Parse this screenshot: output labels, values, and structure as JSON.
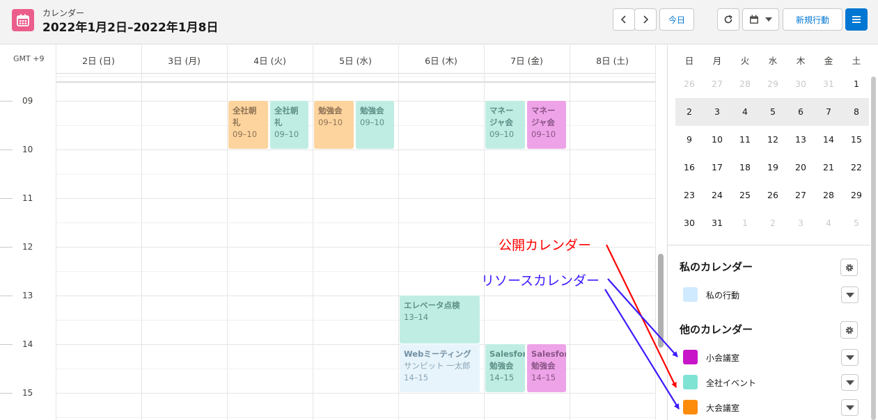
{
  "header": {
    "object_label": "カレンダー",
    "range_title": "2022年1月2日–2022年1月8日",
    "today_label": "今日",
    "new_event_label": "新規行動"
  },
  "timezone": "GMT +9",
  "days": [
    "2日 (日)",
    "3日 (月)",
    "4日 (火)",
    "5日 (水)",
    "6日 (木)",
    "7日 (金)",
    "8日 (土)"
  ],
  "hours": [
    "09",
    "10",
    "11",
    "12",
    "13",
    "14",
    "15"
  ],
  "events": [
    {
      "title": "全社朝礼",
      "sub": "09–10",
      "color": "#fdd49e"
    },
    {
      "title": "全社朝礼",
      "sub": "09–10",
      "color": "#bfede4"
    },
    {
      "title": "勉強会",
      "sub": "09–10",
      "color": "#fdd49e"
    },
    {
      "title": "勉強会",
      "sub": "09–10",
      "color": "#bfede4"
    },
    {
      "title": "マネージャ会",
      "sub": "09–10",
      "color": "#bfede4"
    },
    {
      "title": "マネージャ会",
      "sub": "09–10",
      "color": "#eea3e8"
    },
    {
      "title": "エレベータ点検",
      "sub": "13–14",
      "color": "#bfede4"
    },
    {
      "title": "Webミーティング",
      "sub": "サンピット 一太郎",
      "time": "14–15",
      "color": "#e8f4fb"
    },
    {
      "title": "Salesforce",
      "sub": "勉強会",
      "time": "14–15",
      "color": "#bfede4"
    },
    {
      "title": "Salesforce",
      "sub": "勉強会",
      "time": "14–15",
      "color": "#eea3e8"
    }
  ],
  "mini_calendar": {
    "weekdays": [
      "日",
      "月",
      "火",
      "水",
      "木",
      "金",
      "土"
    ],
    "weeks": [
      [
        "26",
        "27",
        "28",
        "29",
        "30",
        "31",
        "1"
      ],
      [
        "2",
        "3",
        "4",
        "5",
        "6",
        "7",
        "8"
      ],
      [
        "9",
        "10",
        "11",
        "12",
        "13",
        "14",
        "15"
      ],
      [
        "16",
        "17",
        "18",
        "19",
        "20",
        "21",
        "22"
      ],
      [
        "23",
        "24",
        "25",
        "26",
        "27",
        "28",
        "29"
      ],
      [
        "30",
        "31",
        "1",
        "2",
        "3",
        "4",
        "5"
      ]
    ]
  },
  "my_calendars": {
    "title": "私のカレンダー",
    "items": [
      {
        "name": "私の行動",
        "color": "#cfe9fe"
      }
    ]
  },
  "other_calendars": {
    "title": "他のカレンダー",
    "items": [
      {
        "name": "小会議室",
        "color": "#c715c7"
      },
      {
        "name": "全社イベント",
        "color": "#7fe3d4"
      },
      {
        "name": "大会議室",
        "color": "#fe8c0c"
      }
    ]
  },
  "annotations": {
    "public_calendar": {
      "text": "公開カレンダー",
      "color": "#ff0000"
    },
    "resource_calendar": {
      "text": "リソースカレンダー",
      "color": "#3a1aff"
    }
  },
  "icons": [
    "calendar-app-icon",
    "chevron-left-icon",
    "chevron-right-icon",
    "refresh-icon",
    "calendar-view-icon",
    "chevron-down-icon",
    "menu-icon",
    "gear-icon"
  ]
}
